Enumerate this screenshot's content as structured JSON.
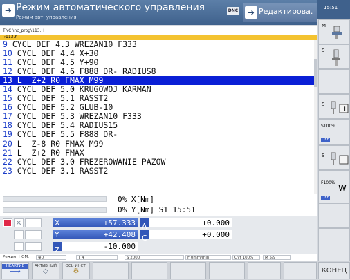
{
  "header": {
    "title": "Режим автоматического управления",
    "subtitle": "Режим авт. управления",
    "dnc_label": "DNC",
    "edit_tab": "Редактирова. табли...",
    "clock": "15:51"
  },
  "program": {
    "path": "TNC:\\nc_prog\\113.H",
    "file": "→113.h",
    "lines": [
      {
        "n": "9",
        "text": " CYCL DEF 4.3 WREZAN10 F333"
      },
      {
        "n": "10",
        "text": " CYCL DEF 4.4 X+30"
      },
      {
        "n": "11",
        "text": " CYCL DEF 4.5 Y+90"
      },
      {
        "n": "12",
        "text": " CYCL DEF 4.6 F888 DR- RADIUS8"
      },
      {
        "n": "13",
        "text": " L  Z+2 R0 FMAX M99"
      },
      {
        "n": "14",
        "text": " CYCL DEF 5.0 KRUGOWOJ KARMAN"
      },
      {
        "n": "15",
        "text": " CYCL DEF 5.1 RASST2"
      },
      {
        "n": "16",
        "text": " CYCL DEF 5.2 GLUB-10"
      },
      {
        "n": "17",
        "text": " CYCL DEF 5.3 WREZAN10 F333"
      },
      {
        "n": "18",
        "text": " CYCL DEF 5.4 RADIUS15"
      },
      {
        "n": "19",
        "text": " CYCL DEF 5.5 F888 DR-"
      },
      {
        "n": "20",
        "text": " L  Z-8 R0 FMAX M99"
      },
      {
        "n": "21",
        "text": " L  Z+2 R0 FMAX"
      },
      {
        "n": "22",
        "text": " CYCL DEF 3.0 FREZEROWANIE PAZOW"
      },
      {
        "n": "23",
        "text": " CYCL DEF 3.1 RASST2"
      }
    ]
  },
  "status": {
    "x_line": "0% X[Nm]",
    "y_line": "0% Y[Nm] S1  15:51"
  },
  "positions": [
    {
      "axis": "X",
      "value": "+57.333",
      "axis2": "A",
      "value2": "+0.000"
    },
    {
      "axis": "Y",
      "value": "+42.408",
      "axis2": "C",
      "value2": "+0.000"
    },
    {
      "axis": "Z",
      "value": "-10.000"
    }
  ],
  "infobar": {
    "mode": "Режим: НОМ.",
    "t": "T 4",
    "s": "S 2000",
    "f": "F 0mm/min",
    "ovr": "Ovr 100%",
    "m": "M 5/9"
  },
  "softkeys": {
    "sk1": "НЕАКТИВ",
    "sk2": "АКТИВНЫЙ",
    "sk3": "ОСЬ ИНСТ.",
    "end": "КОНЕЦ"
  },
  "right_keys": {
    "k1": "M",
    "k2": "S",
    "k3": "S",
    "k4": "S100%",
    "k4b": "OFF",
    "k5": "S",
    "k6": "F100%",
    "k6b": "OFF"
  },
  "colors": {
    "header": "#3f618c",
    "selection": "#0a1fd6",
    "axis_bar": "#3e62c8",
    "file_bar": "#f4c330"
  }
}
